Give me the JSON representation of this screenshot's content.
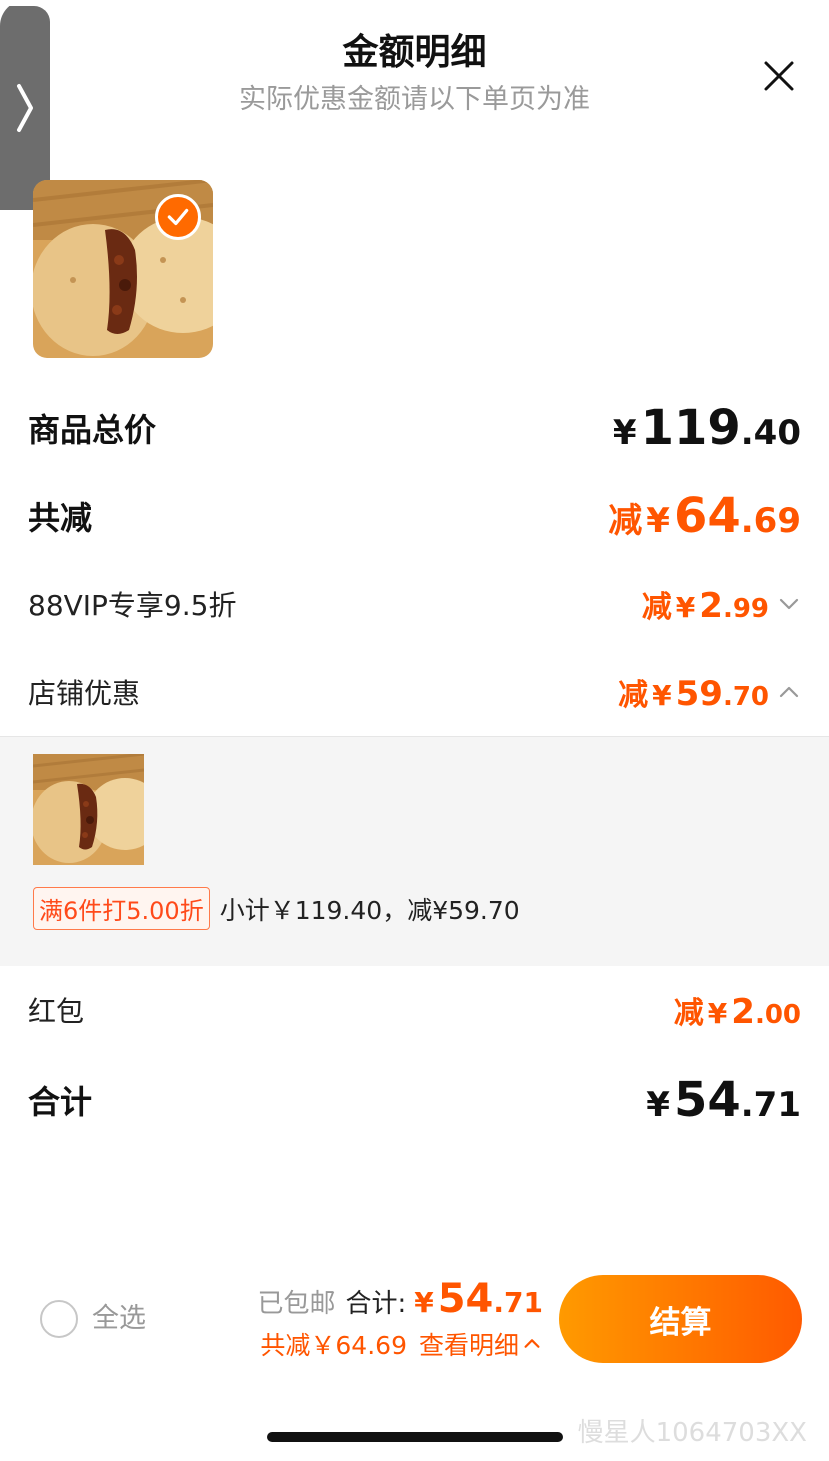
{
  "header": {
    "title": "金额明细",
    "subtitle": "实际优惠金额请以下单页为准"
  },
  "icons": {
    "side_tab": "chevron-right-icon",
    "close": "close-icon",
    "selected": "check-icon",
    "collapsed": "chevron-down-icon",
    "expanded": "chevron-up-icon"
  },
  "colors": {
    "accent": "#ff5500",
    "button_gradient_start": "#ff9a00",
    "button_gradient_end": "#ff5a00"
  },
  "product": {
    "selected": true
  },
  "rows": {
    "total": {
      "label": "商品总价",
      "currency": "¥",
      "int": "119",
      "dec": ".40"
    },
    "discount": {
      "label": "共减",
      "prefix": "减",
      "currency": "¥",
      "int": "64",
      "dec": ".69"
    },
    "vip": {
      "label": "88VIP专享9.5折",
      "prefix": "减",
      "currency": "¥",
      "int": "2",
      "dec": ".99"
    },
    "shop": {
      "label": "店铺优惠",
      "prefix": "减",
      "currency": "¥",
      "int": "59",
      "dec": ".70"
    },
    "redpacket": {
      "label": "红包",
      "prefix": "减",
      "currency": "¥",
      "int": "2",
      "dec": ".00"
    },
    "sum": {
      "label": "合计",
      "currency": "¥",
      "int": "54",
      "dec": ".71"
    }
  },
  "shop_panel": {
    "promo_tag": "满6件打5.00折",
    "promo_text": "小计￥119.40，减¥59.70"
  },
  "footer": {
    "select_all": "全选",
    "shipping": "已包邮",
    "sum_label": "合计:",
    "currency": "¥",
    "sum_int": "54",
    "sum_dec": ".71",
    "discount_text": "共减￥64.69",
    "details_link": "查看明细",
    "checkout": "结算"
  },
  "watermark": "慢星人1064703XX"
}
